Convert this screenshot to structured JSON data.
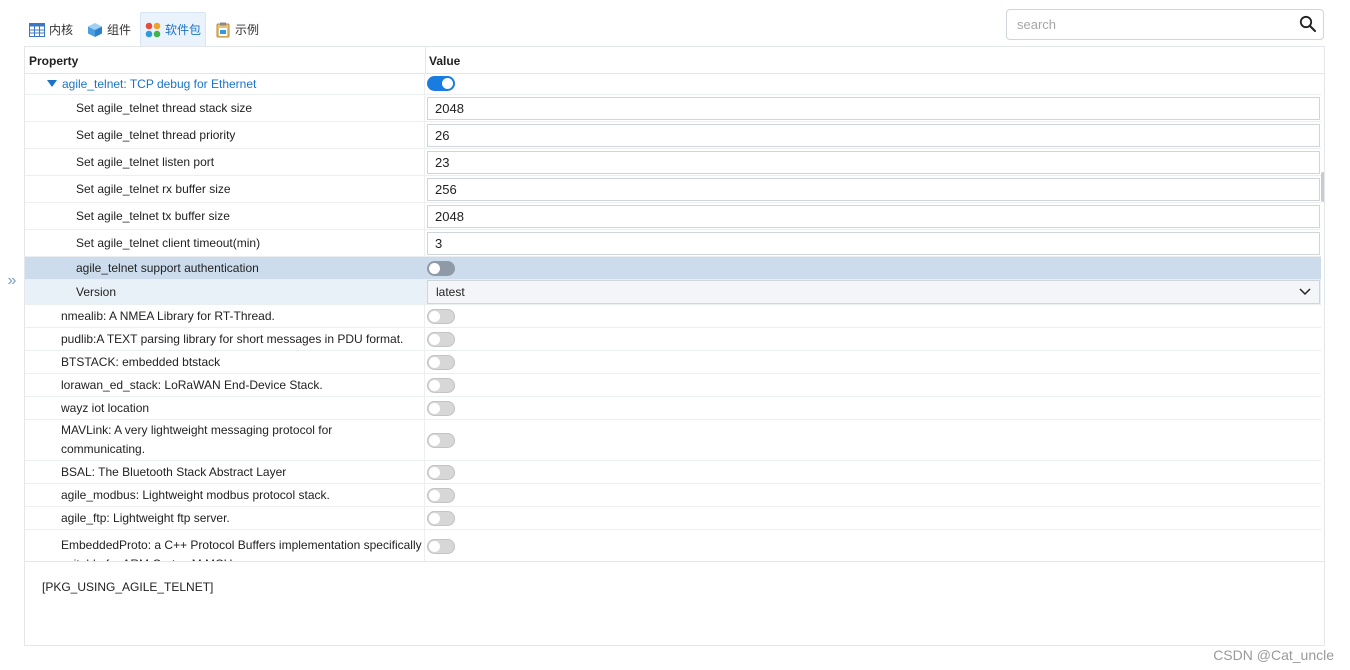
{
  "tabs": [
    {
      "label": "内核",
      "icon": "kernel-table-icon",
      "active": false
    },
    {
      "label": "组件",
      "icon": "component-cube-icon",
      "active": false
    },
    {
      "label": "软件包",
      "icon": "package-dots-icon",
      "active": true
    },
    {
      "label": "示例",
      "icon": "example-clipboard-icon",
      "active": false
    }
  ],
  "search": {
    "placeholder": "search",
    "value": ""
  },
  "table": {
    "header_property": "Property",
    "header_value": "Value",
    "rows": [
      {
        "label": "agile_telnet: TCP debug for Ethernet",
        "kind": "toggle",
        "on": true,
        "indent": 1,
        "parent": true
      },
      {
        "label": "Set agile_telnet thread stack size",
        "kind": "input",
        "value": "2048",
        "indent": 2
      },
      {
        "label": "Set agile_telnet thread priority",
        "kind": "input",
        "value": "26",
        "indent": 2
      },
      {
        "label": "Set agile_telnet listen port",
        "kind": "input",
        "value": "23",
        "indent": 2
      },
      {
        "label": "Set agile_telnet rx buffer size",
        "kind": "input",
        "value": "256",
        "indent": 2
      },
      {
        "label": "Set agile_telnet tx buffer size",
        "kind": "input",
        "value": "2048",
        "indent": 2
      },
      {
        "label": "Set agile_telnet client timeout(min)",
        "kind": "input",
        "value": "3",
        "indent": 2
      },
      {
        "label": "agile_telnet support authentication",
        "kind": "toggle",
        "on": false,
        "indent": 2,
        "selected": true
      },
      {
        "label": "Version",
        "kind": "select",
        "value": "latest",
        "indent": 2,
        "hover": true
      },
      {
        "label": "nmealib: A NMEA Library for RT-Thread.",
        "kind": "toggle",
        "on": false,
        "indent": 0
      },
      {
        "label": "pudlib:A TEXT parsing library for short messages in PDU format.",
        "kind": "toggle",
        "on": false,
        "indent": 0
      },
      {
        "label": "BTSTACK: embedded btstack",
        "kind": "toggle",
        "on": false,
        "indent": 0
      },
      {
        "label": "lorawan_ed_stack: LoRaWAN End-Device Stack.",
        "kind": "toggle",
        "on": false,
        "indent": 0
      },
      {
        "label": "wayz iot location",
        "kind": "toggle",
        "on": false,
        "indent": 0
      },
      {
        "label": "MAVLink: A very lightweight messaging protocol for",
        "label2": "communicating.",
        "kind": "toggle",
        "on": false,
        "indent": 0
      },
      {
        "label": "BSAL: The Bluetooth Stack Abstract Layer",
        "kind": "toggle",
        "on": false,
        "indent": 0
      },
      {
        "label": "agile_modbus: Lightweight modbus protocol stack.",
        "kind": "toggle",
        "on": false,
        "indent": 0
      },
      {
        "label": "agile_ftp: Lightweight ftp server.",
        "kind": "toggle",
        "on": false,
        "indent": 0
      },
      {
        "label": "EmbeddedProto: a C++ Protocol Buffers implementation specifically",
        "label2": "suitable for ARM Cortex-M MCUs",
        "kind": "toggle",
        "on": false,
        "indent": 0
      }
    ]
  },
  "description": "[PKG_USING_AGILE_TELNET]",
  "watermark": "CSDN @Cat_uncle",
  "colors": {
    "accent": "#1a73c8",
    "toggle_on": "#1a7ce0",
    "selected_row": "#ccdcec"
  }
}
